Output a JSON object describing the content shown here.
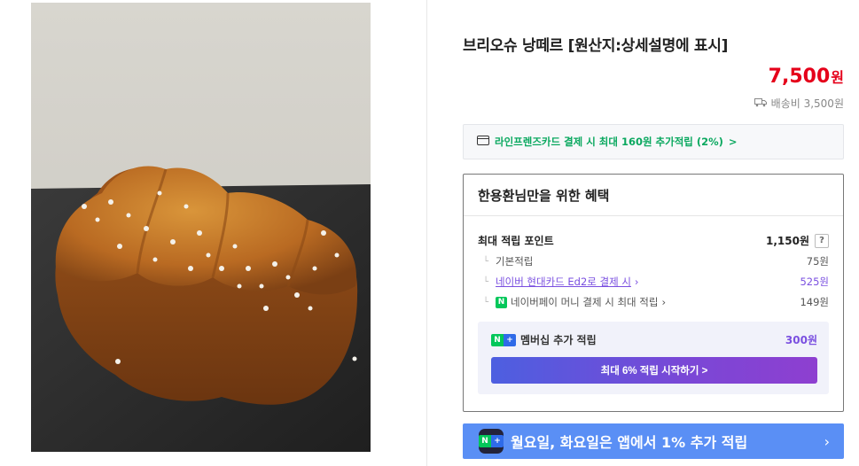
{
  "product": {
    "title": "브리오슈 낭떼르 [원산지:상세설명에 표시]",
    "price": "7,500",
    "price_unit": "원",
    "shipping": "배송비 3,500원"
  },
  "card_promo": {
    "text": "라인프렌즈카드 결제 시 최대 160원 추가적립 (2%)",
    "chevron": ">"
  },
  "benefits": {
    "title": "한용환님만을 위한 혜택",
    "max_points_label": "최대 적립 포인트",
    "max_points_value": "1,150원",
    "help": "?",
    "items": [
      {
        "label": "기본적립",
        "value": "75원"
      },
      {
        "label": "네이버 현대카드 Ed2로 결제 시",
        "value": "525원"
      },
      {
        "label": "네이버페이 머니 결제 시 최대 적립",
        "value": "149원"
      }
    ],
    "membership_label": "멤버십 추가 적립",
    "membership_value": "300원",
    "start_button": "최대 6% 적립 시작하기 >"
  },
  "app_banner": {
    "text": "월요일, 화요일은 앱에서 1% 추가 적립",
    "chevron": "›"
  },
  "colors": {
    "price": "#e5001a",
    "green": "#0aa85f",
    "purple": "#7a4fe0",
    "banner": "#5a8ff5"
  }
}
